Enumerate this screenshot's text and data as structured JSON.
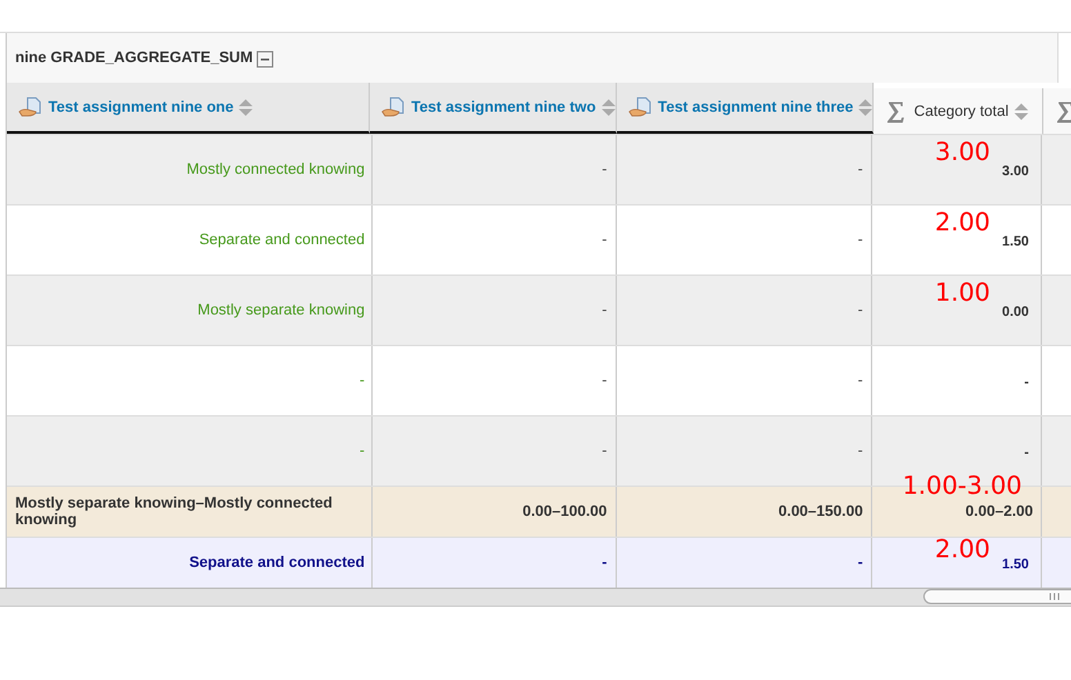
{
  "category": {
    "title": "nine GRADE_AGGREGATE_SUM",
    "expanded": true
  },
  "columns": [
    {
      "kind": "assignment",
      "label": "Test assignment nine one"
    },
    {
      "kind": "assignment",
      "label": "Test assignment nine two"
    },
    {
      "kind": "assignment",
      "label": "Test assignment nine three"
    },
    {
      "kind": "total",
      "label": "Category total"
    },
    {
      "kind": "total"
    }
  ],
  "rows": [
    {
      "kind": "grade",
      "cells": [
        "Mostly connected knowing",
        "-",
        "-",
        "3.00"
      ],
      "annotation": "3.00"
    },
    {
      "kind": "grade",
      "cells": [
        "Separate and connected",
        "-",
        "-",
        "1.50"
      ],
      "annotation": "2.00"
    },
    {
      "kind": "grade",
      "cells": [
        "Mostly separate knowing",
        "-",
        "-",
        "0.00"
      ],
      "annotation": "1.00"
    },
    {
      "kind": "grade",
      "cells": [
        "-",
        "-",
        "-",
        "-"
      ]
    },
    {
      "kind": "grade",
      "cells": [
        "-",
        "-",
        "-",
        "-"
      ]
    },
    {
      "kind": "range",
      "cells": [
        "Mostly separate knowing–Mostly connected knowing",
        "0.00–100.00",
        "0.00–150.00",
        "0.00–2.00"
      ],
      "annotation": "1.00-3.00"
    },
    {
      "kind": "average",
      "cells": [
        "Separate and connected",
        "-",
        "-",
        "1.50"
      ],
      "annotation": "2.00"
    }
  ]
}
